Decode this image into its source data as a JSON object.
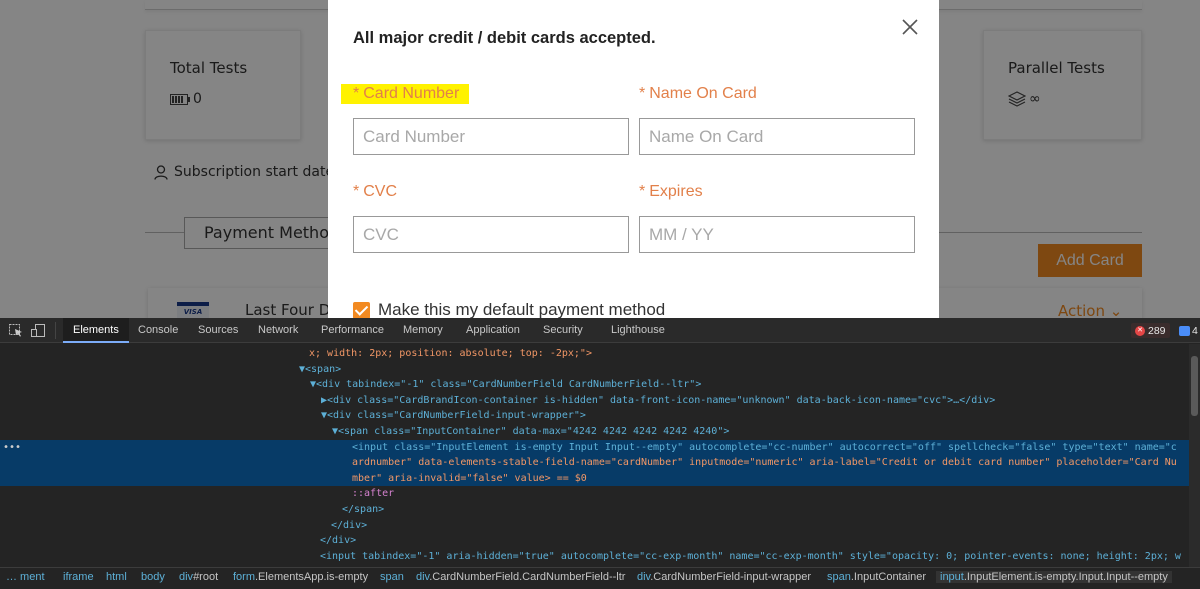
{
  "dashboard": {
    "stats": [
      {
        "title": "Total Tests",
        "value": "0",
        "icon": "battery-icon"
      },
      {
        "title": "Parallel Tests",
        "value": "∞",
        "icon": "layers-icon"
      }
    ],
    "subscription_label": "Subscription start date",
    "payment_tab_label": "Payment Metho",
    "add_card_label": "Add Card",
    "last_four_label": "Last Four Di",
    "action_label": "Action ⌄",
    "visa_text": "VISA"
  },
  "modal": {
    "title": "All major credit / debit cards accepted.",
    "fields": [
      {
        "label": "Card Number",
        "placeholder": "Card Number",
        "value": "",
        "highlighted": true
      },
      {
        "label": "Name On Card",
        "placeholder": "Name On Card",
        "value": ""
      },
      {
        "label": "CVC",
        "placeholder": "CVC",
        "value": ""
      },
      {
        "label": "Expires",
        "placeholder": "MM / YY",
        "value": ""
      }
    ],
    "required_mark": "*",
    "default_payment_label": "Make this my default payment method",
    "default_payment_checked": true,
    "accent_color": "#f28a21",
    "label_color": "#e2804a"
  },
  "devtools": {
    "tabs": [
      "Elements",
      "Console",
      "Sources",
      "Network",
      "Performance",
      "Memory",
      "Application",
      "Security",
      "Lighthouse"
    ],
    "active_tab": "Elements",
    "error_count": "289",
    "message_count": "4",
    "dom_lines": [
      "x; width: 2px; position: absolute; top: -2px;\">",
      "▼<span>",
      "▼<div tabindex=\"-1\" class=\"CardNumberField CardNumberField--ltr\">",
      "▶<div class=\"CardBrandIcon-container is-hidden\" data-front-icon-name=\"unknown\" data-back-icon-name=\"cvc\">…</div>",
      "▼<div class=\"CardNumberField-input-wrapper\">",
      "▼<span class=\"InputContainer\" data-max=\"4242 4242 4242 4242 4240\">",
      "<input class=\"InputElement is-empty Input Input--empty\" autocomplete=\"cc-number\" autocorrect=\"off\" spellcheck=\"false\" type=\"text\" name=\"c",
      "ardnumber\" data-elements-stable-field-name=\"cardNumber\" inputmode=\"numeric\" aria-label=\"Credit or debit card number\" placeholder=\"Card Nu",
      "mber\" aria-invalid=\"false\" value> == $0",
      "::after",
      "</span>",
      "</div>",
      "</div>",
      "<input tabindex=\"-1\" aria-hidden=\"true\" autocomplete=\"cc-exp-month\" name=\"cc-exp-month\" style=\"opacity: 0; pointer-events: none; height: 2px; w"
    ],
    "breadcrumbs": [
      {
        "tag": "…  ment",
        "cls": ""
      },
      {
        "tag": "iframe",
        "cls": ""
      },
      {
        "tag": "html",
        "cls": ""
      },
      {
        "tag": "body",
        "cls": ""
      },
      {
        "tag": "div",
        "cls": "#root"
      },
      {
        "tag": "form",
        "cls": ".ElementsApp.is-empty"
      },
      {
        "tag": "span",
        "cls": ""
      },
      {
        "tag": "div",
        "cls": ".CardNumberField.CardNumberField--ltr"
      },
      {
        "tag": "div",
        "cls": ".CardNumberField-input-wrapper"
      },
      {
        "tag": "span",
        "cls": ".InputContainer"
      },
      {
        "tag": "input",
        "cls": ".InputElement.is-empty.Input.Input--empty"
      }
    ]
  }
}
